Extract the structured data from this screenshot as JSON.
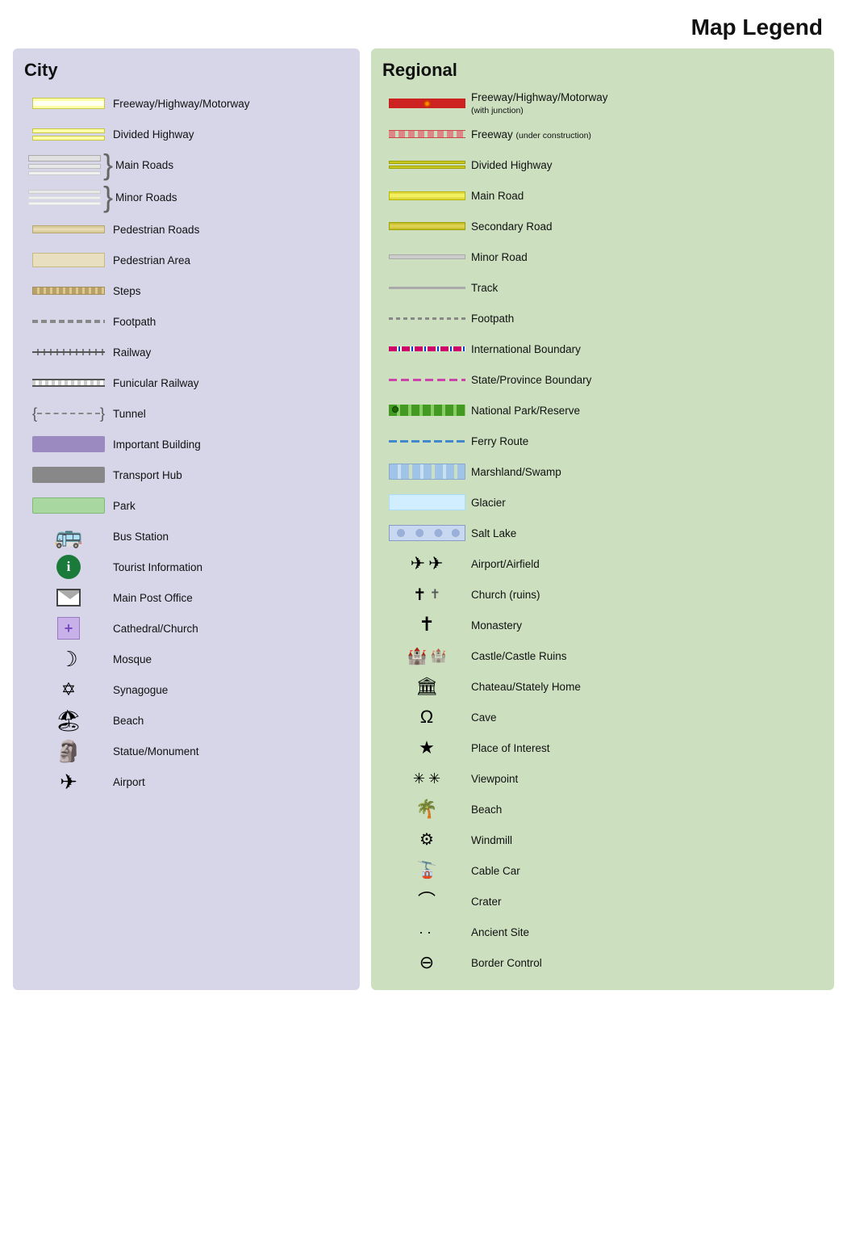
{
  "title": "Map Legend",
  "city": {
    "heading": "City",
    "items": [
      {
        "label": "Freeway/Highway/Motorway",
        "type": "freeway-city"
      },
      {
        "label": "Divided Highway",
        "type": "divided-city"
      },
      {
        "label": "Main Roads",
        "type": "main-roads-brace"
      },
      {
        "label": "Minor Roads",
        "type": "minor-roads-brace"
      },
      {
        "label": "Pedestrian Roads",
        "type": "pedestrian-roads"
      },
      {
        "label": "Pedestrian Area",
        "type": "pedestrian-area"
      },
      {
        "label": "Steps",
        "type": "steps"
      },
      {
        "label": "Footpath",
        "type": "footpath-city"
      },
      {
        "label": "Railway",
        "type": "railway"
      },
      {
        "label": "Funicular Railway",
        "type": "funicular"
      },
      {
        "label": "Tunnel",
        "type": "tunnel"
      },
      {
        "label": "Important Building",
        "type": "important-building"
      },
      {
        "label": "Transport Hub",
        "type": "transport-hub"
      },
      {
        "label": "Park",
        "type": "park"
      },
      {
        "label": "Bus Station",
        "type": "bus-station"
      },
      {
        "label": "Tourist Information",
        "type": "tourist-info"
      },
      {
        "label": "Main Post Office",
        "type": "post-office"
      },
      {
        "label": "Cathedral/Church",
        "type": "cathedral"
      },
      {
        "label": "Mosque",
        "type": "mosque"
      },
      {
        "label": "Synagogue",
        "type": "synagogue"
      },
      {
        "label": "Beach",
        "type": "beach-city"
      },
      {
        "label": "Statue/Monument",
        "type": "statue"
      },
      {
        "label": "Airport",
        "type": "airport-city"
      }
    ]
  },
  "regional": {
    "heading": "Regional",
    "items": [
      {
        "label": "Freeway/Highway/Motorway",
        "sublabel": "(with junction)",
        "type": "reg-freeway"
      },
      {
        "label": "Freeway",
        "sublabel": "(under construction)",
        "type": "reg-freeway-uc"
      },
      {
        "label": "Divided Highway",
        "type": "reg-divided"
      },
      {
        "label": "Main Road",
        "type": "reg-main-road"
      },
      {
        "label": "Secondary Road",
        "type": "reg-secondary"
      },
      {
        "label": "Minor Road",
        "type": "reg-minor"
      },
      {
        "label": "Track",
        "type": "reg-track"
      },
      {
        "label": "Footpath",
        "type": "reg-footpath"
      },
      {
        "label": "International Boundary",
        "type": "reg-intl"
      },
      {
        "label": "State/Province Boundary",
        "type": "reg-state"
      },
      {
        "label": "National Park/Reserve",
        "type": "reg-natpark"
      },
      {
        "label": "Ferry Route",
        "type": "reg-ferry"
      },
      {
        "label": "Marshland/Swamp",
        "type": "reg-marsh"
      },
      {
        "label": "Glacier",
        "type": "reg-glacier"
      },
      {
        "label": "Salt Lake",
        "type": "reg-saltlake"
      },
      {
        "label": "Airport/Airfield",
        "type": "reg-airport"
      },
      {
        "label": "Church (ruins)",
        "type": "reg-church"
      },
      {
        "label": "Monastery",
        "type": "reg-monastery"
      },
      {
        "label": "Castle/Castle Ruins",
        "type": "reg-castle"
      },
      {
        "label": "Chateau/Stately Home",
        "type": "reg-chateau"
      },
      {
        "label": "Cave",
        "type": "reg-cave"
      },
      {
        "label": "Place of Interest",
        "type": "reg-interest"
      },
      {
        "label": "Viewpoint",
        "type": "reg-viewpoint"
      },
      {
        "label": "Beach",
        "type": "reg-beach"
      },
      {
        "label": "Windmill",
        "type": "reg-windmill"
      },
      {
        "label": "Cable Car",
        "type": "reg-cablecar"
      },
      {
        "label": "Crater",
        "type": "reg-crater"
      },
      {
        "label": "Ancient Site",
        "type": "reg-ancient"
      },
      {
        "label": "Border Control",
        "type": "reg-border"
      }
    ]
  }
}
